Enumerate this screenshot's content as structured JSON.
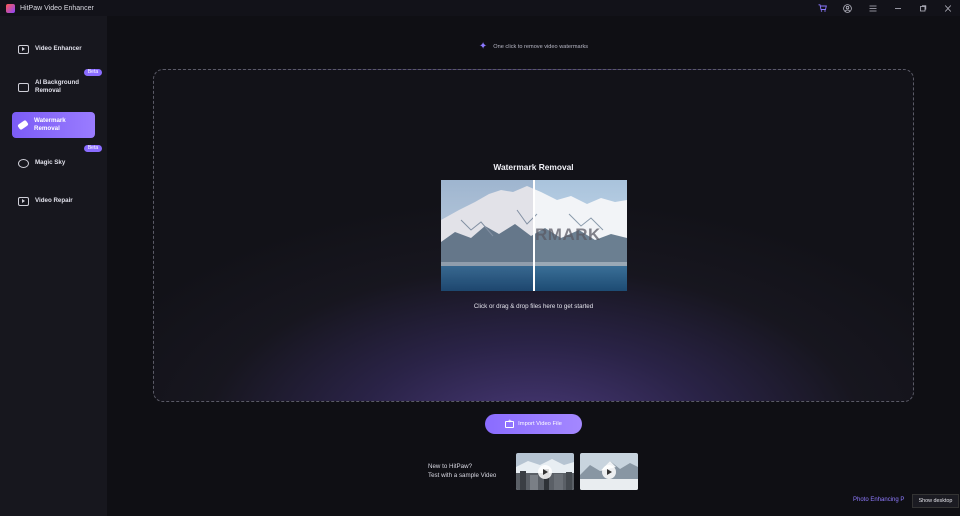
{
  "app": {
    "title": "HitPaw Video Enhancer"
  },
  "titlebar_icons": [
    "cart-icon",
    "account-icon",
    "menu-icon",
    "minimize-icon",
    "restore-icon",
    "close-icon"
  ],
  "sidebar": {
    "items": [
      {
        "label": "Video Enhancer",
        "icon": "video-play-icon",
        "active": false
      },
      {
        "label": "AI Background Removal",
        "icon": "portrait-icon",
        "active": false,
        "badge": "Beta"
      },
      {
        "label": "Watermark Removal",
        "icon": "eraser-icon",
        "active": true
      },
      {
        "label": "Magic Sky",
        "icon": "sky-icon",
        "active": false,
        "badge": "Beta"
      },
      {
        "label": "Video Repair",
        "icon": "repair-icon",
        "active": false
      }
    ]
  },
  "main": {
    "hint": "One click to remove video watermarks",
    "dropzone": {
      "title": "Watermark Removal",
      "watermark_text": "RMARK",
      "subtitle": "Click or drag & drop files here to get started"
    },
    "import_button": "Import Video File",
    "sample": {
      "line1": "New to HitPaw?",
      "line2": "Test with a sample Video"
    },
    "photo_link": "Photo Enhancing P"
  },
  "taskbar": {
    "show_desktop": "Show desktop"
  },
  "colors": {
    "accent": "#8a6cff",
    "background": "#0f0f14",
    "sidebar": "#17171e"
  }
}
